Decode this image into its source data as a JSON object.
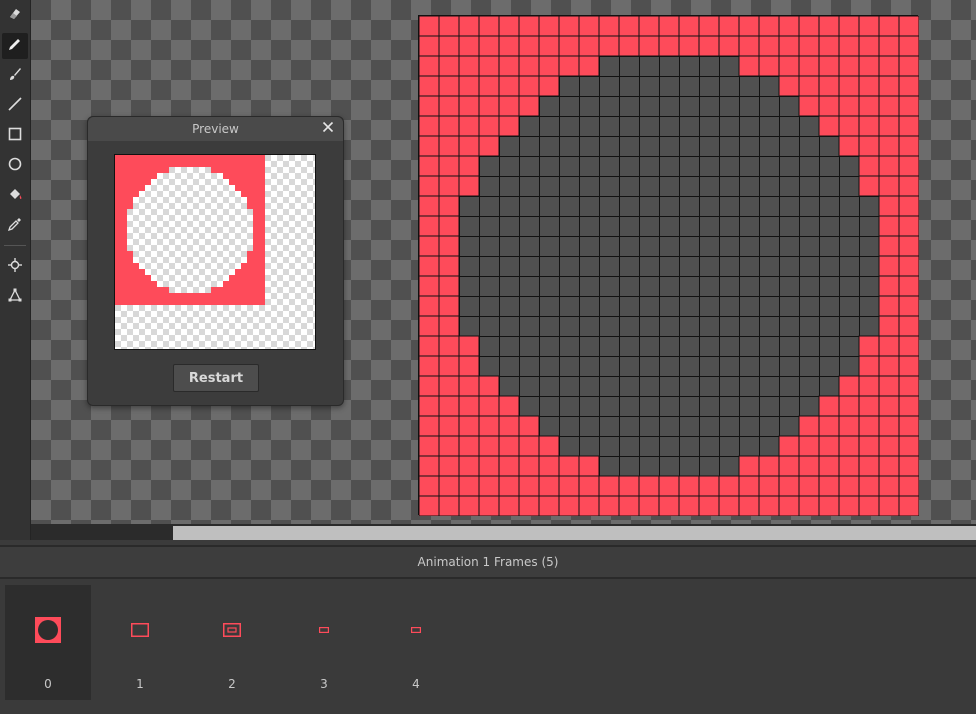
{
  "tools": [
    {
      "name": "eraser-icon"
    },
    {
      "name": "pencil-icon",
      "active": true
    },
    {
      "name": "brush-icon"
    },
    {
      "name": "line-icon"
    },
    {
      "name": "rectangle-icon"
    },
    {
      "name": "ellipse-icon"
    },
    {
      "name": "fill-bucket-icon"
    },
    {
      "name": "eyedropper-icon"
    },
    {
      "name": "move-icon"
    },
    {
      "name": "transform-icon"
    }
  ],
  "sprite": {
    "grid_size": 25,
    "fill_color": "#fe4b5a",
    "hole_color": "#505050"
  },
  "preview": {
    "title": "Preview",
    "restart_label": "Restart"
  },
  "timeline": {
    "title": "Animation 1 Frames (5)",
    "frames": [
      {
        "number": "0",
        "active": true
      },
      {
        "number": "1",
        "active": false
      },
      {
        "number": "2",
        "active": false
      },
      {
        "number": "3",
        "active": false
      },
      {
        "number": "4",
        "active": false
      }
    ]
  }
}
